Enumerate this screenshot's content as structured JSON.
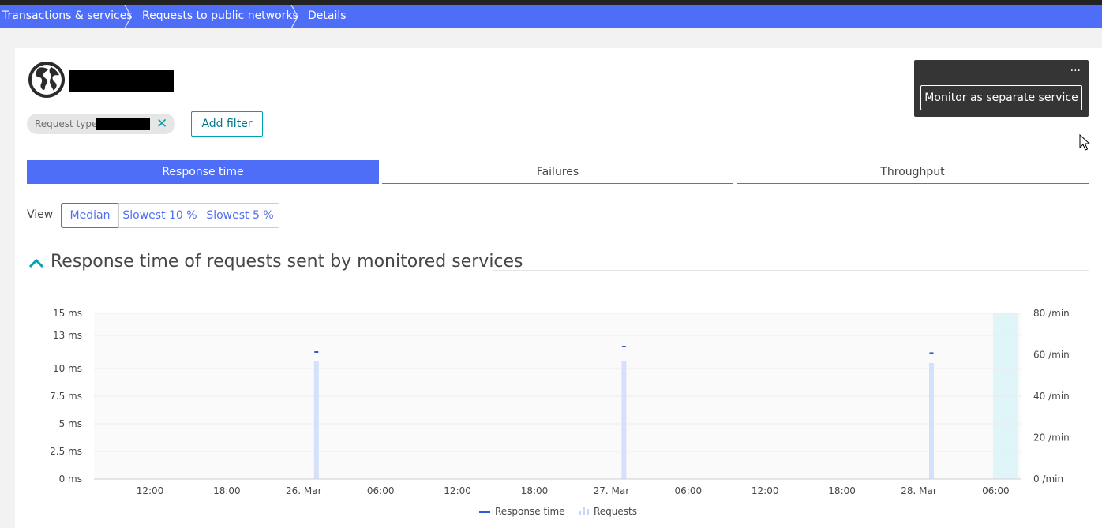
{
  "breadcrumb": {
    "items": [
      "Transactions & services",
      "Requests to public networks",
      "Details"
    ]
  },
  "filters": {
    "chip_label": "Request type:",
    "add_filter_label": "Add filter"
  },
  "panel": {
    "menu_label": "...",
    "monitor_label": "Monitor as separate service"
  },
  "tabs": [
    "Response time",
    "Failures",
    "Throughput"
  ],
  "view": {
    "label": "View",
    "options": [
      "Median",
      "Slowest 10 %",
      "Slowest 5 %"
    ],
    "selected": "Median"
  },
  "section": {
    "title": "Response time of requests sent by monitored services"
  },
  "colors": {
    "accent": "#4f6ef7",
    "teal": "#00a1b2",
    "request_bar": "#d5e1fb",
    "response_line": "#2f5bd6",
    "highlight": "#e0f5f7"
  },
  "chart_data": {
    "type": "bar",
    "x_tick_labels": [
      "12:00",
      "18:00",
      "26. Mar",
      "06:00",
      "12:00",
      "18:00",
      "27. Mar",
      "06:00",
      "12:00",
      "18:00",
      "28. Mar",
      "06:00"
    ],
    "y_left_ticks": [
      "15 ms",
      "13 ms",
      "10 ms",
      "7.5 ms",
      "5 ms",
      "2.5 ms",
      "0 ms"
    ],
    "y_right_ticks": [
      "80 /min",
      "60 /min",
      "40 /min",
      "20 /min",
      "0 /min"
    ],
    "ylim_left": [
      0,
      15
    ],
    "ylim_right": [
      0,
      80
    ],
    "series": [
      {
        "name": "Response time",
        "unit": "ms",
        "points": [
          {
            "x": "26. Mar 00:00",
            "y": 11.5
          },
          {
            "x": "27. Mar 00:00",
            "y": 12.0
          },
          {
            "x": "28. Mar 00:00",
            "y": 11.4
          }
        ]
      },
      {
        "name": "Requests",
        "unit": "/min",
        "points": [
          {
            "x": "26. Mar 00:00",
            "y": 57
          },
          {
            "x": "27. Mar 00:00",
            "y": 57
          },
          {
            "x": "28. Mar 00:00",
            "y": 56
          }
        ]
      }
    ],
    "legend": [
      "Response time",
      "Requests"
    ],
    "legend_position": "bottom-center",
    "grid": true
  }
}
